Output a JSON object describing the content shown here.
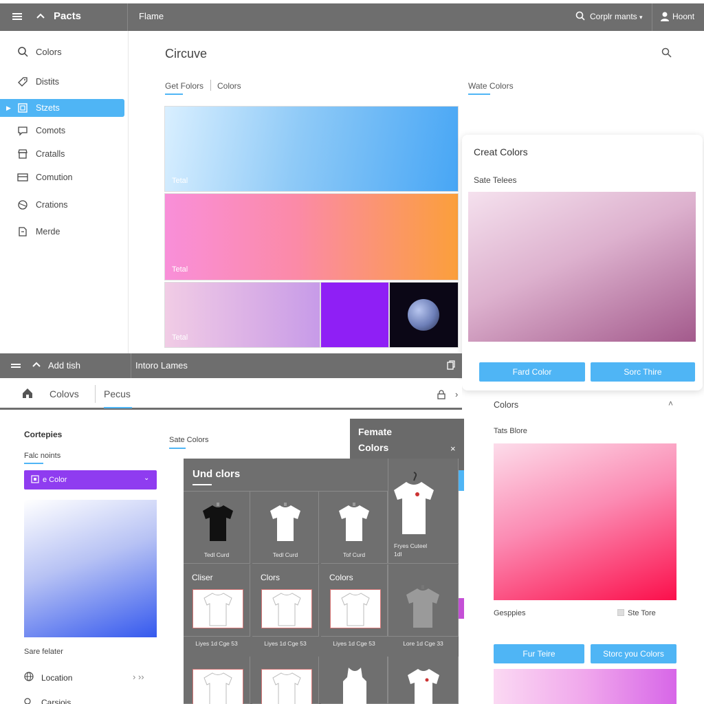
{
  "topbar": {
    "app_title": "Pacts",
    "center_label": "Flame",
    "search_label": "Corplr mants",
    "user_label": "Hoont"
  },
  "sidebar": {
    "items": [
      {
        "label": "Colors",
        "icon": "search-icon"
      },
      {
        "label": "Distits",
        "icon": "tag-icon"
      },
      {
        "label": "Stzets",
        "icon": "image-icon",
        "active": true
      },
      {
        "label": "Comots",
        "icon": "comment-icon"
      },
      {
        "label": "Cratalls",
        "icon": "store-icon"
      },
      {
        "label": "Comution",
        "icon": "card-icon"
      },
      {
        "label": "Crations",
        "icon": "circle-icon"
      },
      {
        "label": "Merde",
        "icon": "document-icon"
      }
    ]
  },
  "main": {
    "title": "Circuve",
    "tabs": [
      "Get Folors",
      "Colors"
    ],
    "right_tab": "Wate Colors",
    "swatch_labels": [
      "Tetal",
      "Tetal",
      "Tetal"
    ]
  },
  "card": {
    "title": "Creat Colors",
    "subtitle": "Sate Telees",
    "button_left": "Fard Color",
    "button_right": "Sorc Thire"
  },
  "window2": {
    "bar_title": "Add tish",
    "bar_center": "Intoro Lames",
    "tabs": [
      "Colovs",
      "Pecus"
    ],
    "panel_title": "Cortepies",
    "sub_label": "Falc noints",
    "select_value": "e Color",
    "mid_label": "Sate Colors",
    "bottom_label": "Sare felater",
    "location_label": "Location",
    "last_label": "Carsiois"
  },
  "popup": {
    "title_line1": "Femate",
    "title_line2": "Colors"
  },
  "grid": {
    "title": "Und clors",
    "row1": [
      "Tedl Curd",
      "Tedl Curd",
      "Tof Curd"
    ],
    "row1_last": [
      "Fryes Cuteel",
      "1dl"
    ],
    "row2_headers": [
      "Cliser",
      "Clors",
      "Colors"
    ],
    "row2_captions": [
      "Liyes 1d Cge 53",
      "Liyes 1d Cge 53",
      "Liyes 1d Cge 53",
      "Lore 1d Cge 33"
    ]
  },
  "right_panel": {
    "title": "Colors",
    "label": "Tats Blore",
    "caption_left": "Gesppies",
    "caption_right": "Ste Tore",
    "button_left": "Fur Teire",
    "button_right": "Storc you Colors"
  },
  "colors": {
    "accent": "#4fb5f5",
    "bar": "#6e6e6e",
    "purple": "#8f3cf0"
  }
}
